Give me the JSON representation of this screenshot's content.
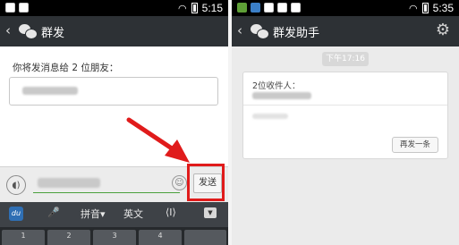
{
  "left": {
    "status": {
      "time": "5:15"
    },
    "header": {
      "back_glyph": "‹",
      "title": "群发"
    },
    "content": {
      "send_to_text": "你将发消息给 2 位朋友："
    },
    "input": {
      "send_label": "发送",
      "voice_glyph": "◖)",
      "emoji_glyph": "☺"
    },
    "keyboard": {
      "logo_text": "du",
      "mic_glyph": "🎤",
      "pinyin_label": "拼音▾",
      "english_label": "英文",
      "cursor_glyph": "⟨I⟩",
      "hide_glyph": "▼",
      "keys": [
        "1",
        "2",
        "3",
        "4"
      ]
    }
  },
  "right": {
    "status": {
      "time": "5:35"
    },
    "header": {
      "back_glyph": "‹",
      "title": "群发助手",
      "settings_glyph": "⚙"
    },
    "message": {
      "time": "下午17:16",
      "recipients_label": "2位收件人：",
      "resend_label": "再发一条"
    }
  },
  "colors": {
    "highlight": "#e01b1b",
    "titlebar": "#2d3135",
    "input_accent": "#4aa03c"
  }
}
